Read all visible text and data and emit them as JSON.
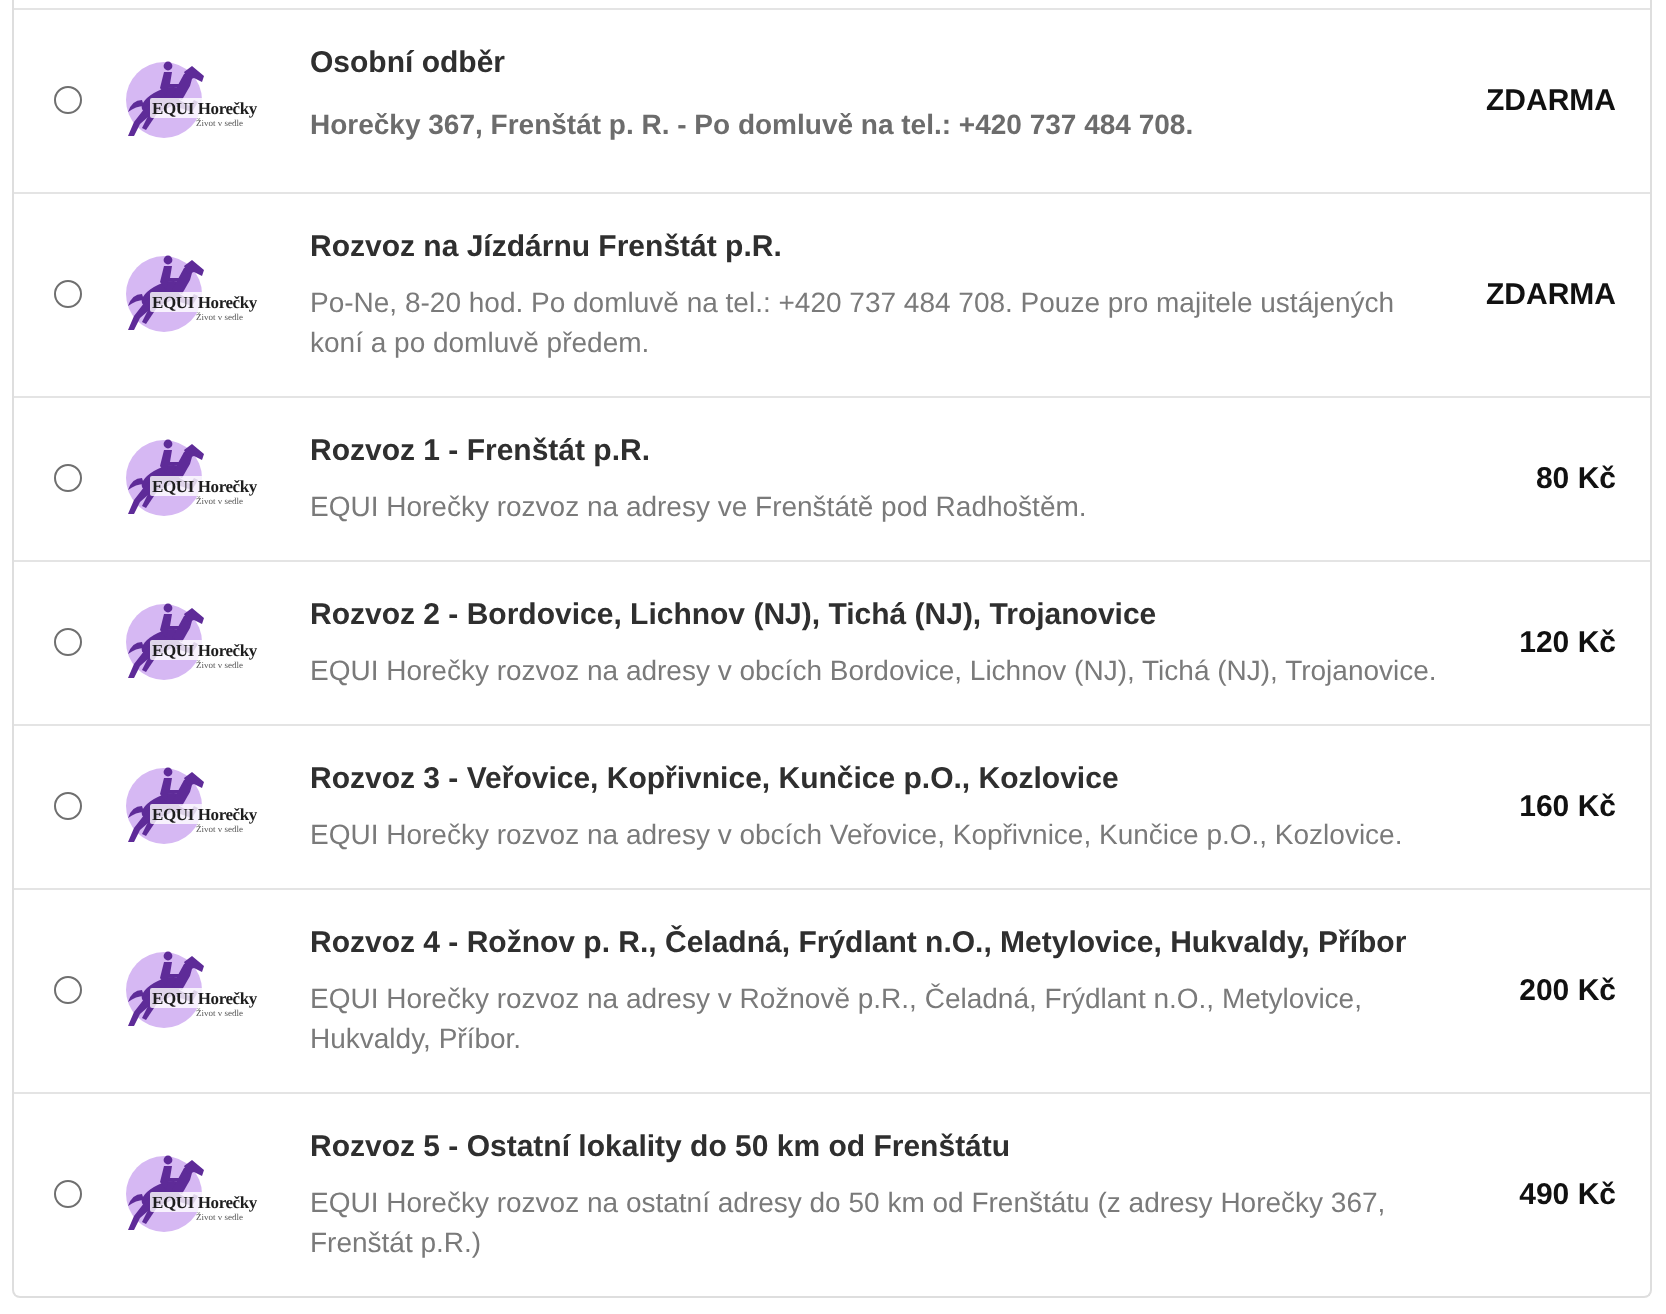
{
  "shipping_options": [
    {
      "selected": false,
      "logo": {
        "name": "EQUI Horečky",
        "tagline": "Život v sedle"
      },
      "title": "Osobní odběr",
      "description": "Horečky 367, Frenštát p. R. - Po domluvě na tel.: +420 737 484 708.",
      "bold_description": true,
      "price": "ZDARMA"
    },
    {
      "selected": false,
      "logo": {
        "name": "EQUI Horečky",
        "tagline": "Život v sedle"
      },
      "title": "Rozvoz na Jízdárnu Frenštát p.R.",
      "description": "Po-Ne, 8-20 hod. Po domluvě na tel.: +420 737 484 708. Pouze pro majitele ustájených koní a po domluvě předem.",
      "bold_description": false,
      "price": "ZDARMA"
    },
    {
      "selected": false,
      "logo": {
        "name": "EQUI Horečky",
        "tagline": "Život v sedle"
      },
      "title": "Rozvoz 1 - Frenštát p.R.",
      "description": "EQUI Horečky rozvoz na adresy ve Frenštátě pod Radhoštěm.",
      "bold_description": false,
      "price": "80 Kč"
    },
    {
      "selected": false,
      "logo": {
        "name": "EQUI Horečky",
        "tagline": "Život v sedle"
      },
      "title": "Rozvoz 2 - Bordovice, Lichnov (NJ), Tichá (NJ), Trojanovice",
      "description": "EQUI Horečky rozvoz na adresy v obcích Bordovice, Lichnov (NJ), Tichá (NJ), Trojanovice.",
      "bold_description": false,
      "price": "120 Kč"
    },
    {
      "selected": false,
      "logo": {
        "name": "EQUI Horečky",
        "tagline": "Život v sedle"
      },
      "title": "Rozvoz 3 - Veřovice, Kopřivnice, Kunčice p.O., Kozlovice",
      "description": "EQUI Horečky rozvoz na adresy v obcích Veřovice, Kopřivnice, Kunčice p.O., Kozlovice.",
      "bold_description": false,
      "price": "160 Kč"
    },
    {
      "selected": false,
      "logo": {
        "name": "EQUI Horečky",
        "tagline": "Život v sedle"
      },
      "title": "Rozvoz 4 - Rožnov p. R., Čeladná, Frýdlant n.O., Metylovice, Hukvaldy, Příbor",
      "description": "EQUI Horečky rozvoz na adresy v Rožnově p.R., Čeladná, Frýdlant n.O., Metylovice, Hukvaldy, Příbor.",
      "bold_description": false,
      "price": "200 Kč"
    },
    {
      "selected": false,
      "logo": {
        "name": "EQUI Horečky",
        "tagline": "Život v sedle"
      },
      "title": "Rozvoz 5 - Ostatní lokality do 50 km od Frenštátu",
      "description": "EQUI Horečky rozvoz na ostatní adresy do 50 km od Frenštátu (z adresy Horečky 367, Frenštát p.R.)",
      "bold_description": false,
      "price": "490 Kč"
    }
  ]
}
